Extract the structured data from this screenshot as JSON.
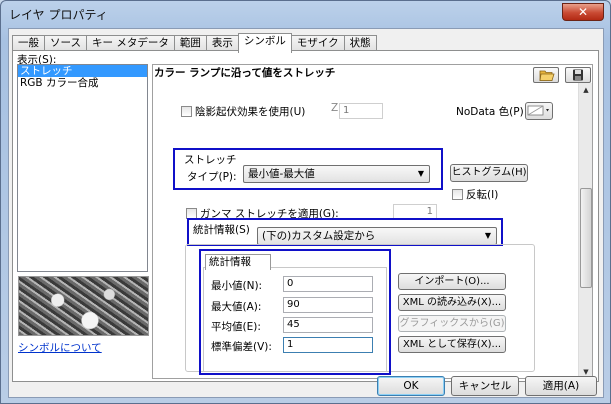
{
  "window": {
    "title": "レイヤ プロパティ",
    "close_glyph": "✕"
  },
  "tabs": [
    "一般",
    "ソース",
    "キー メタデータ",
    "範囲",
    "表示",
    "シンボル",
    "モザイク",
    "状態"
  ],
  "sidebar": {
    "show_label": "表示(S):",
    "items": [
      "ストレッチ",
      "RGB カラー合成"
    ],
    "about_link": "シンボルについて"
  },
  "main": {
    "heading": "カラー ランプに沿って値をストレッチ",
    "hillshade": {
      "label": "陰影起伏効果を使用(U)",
      "z_label": "Z:",
      "z_value": "1"
    },
    "nodata": {
      "label": "NoData 色(P):"
    },
    "stretch": {
      "group_label": "ストレッチ",
      "type_label": "タイプ(P):",
      "type_value": "最小値-最大値"
    },
    "histogram_button": "ヒストグラム(H)",
    "invert_label": "反転(I)",
    "gamma": {
      "label": "ガンマ ストレッチを適用(G):",
      "value": "1"
    },
    "statistics": {
      "label": "統計情報(S)",
      "value": "(下の)カスタム設定から"
    },
    "stats_tab": "統計情報",
    "fields": [
      {
        "label": "最小値(N):",
        "value": "0"
      },
      {
        "label": "最大値(A):",
        "value": "90"
      },
      {
        "label": "平均値(E):",
        "value": "45"
      },
      {
        "label": "標準偏差(V):",
        "value": "1"
      }
    ],
    "buttons": {
      "import": "インポート(O)...",
      "xml_load": "XML の読み込み(X)...",
      "from_graphics": "グラフィックスから(G)",
      "xml_save": "XML として保存(X)..."
    }
  },
  "footer": {
    "ok": "OK",
    "cancel": "キャンセル",
    "apply": "適用(A)"
  }
}
